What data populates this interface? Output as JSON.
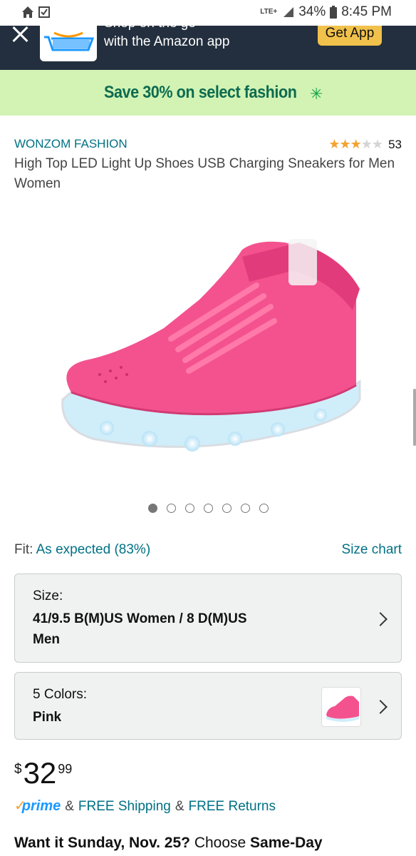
{
  "status_bar": {
    "network": "LTE+",
    "battery": "34%",
    "time": "8:45 PM"
  },
  "app_banner": {
    "text_top": "Shop on the go",
    "text": "with the Amazon app",
    "button": "Get App"
  },
  "promo": {
    "text": "Save 30% on select fashion"
  },
  "product": {
    "brand": "WONZOM FASHION",
    "rating_stars": 3,
    "review_count": "53",
    "title": "High Top LED Light Up Shoes USB Charging Sneakers for Men Women",
    "image_count": 7,
    "active_image": 1
  },
  "fit": {
    "label": "Fit:",
    "value": "As expected (83%)",
    "size_chart": "Size chart"
  },
  "size_option": {
    "label": "Size:",
    "value": "41/9.5 B(M)US Women / 8 D(M)US Men"
  },
  "color_option": {
    "label": "5 Colors:",
    "value": "Pink"
  },
  "price": {
    "symbol": "$",
    "whole": "32",
    "fraction": "99"
  },
  "shipping": {
    "prime": "prime",
    "amp1": "&",
    "free_shipping": "FREE Shipping",
    "amp2": "&",
    "free_returns": "FREE Returns"
  },
  "delivery": {
    "lead": "Want it Sunday, Nov. 25?",
    "choose": "Choose",
    "option": "Same-Day"
  },
  "colors": {
    "banner_bg": "#232f3e",
    "promo_bg": "#d2f3b4",
    "link": "#007185",
    "button": "#f0c14b",
    "shoe": "#f4528f"
  }
}
